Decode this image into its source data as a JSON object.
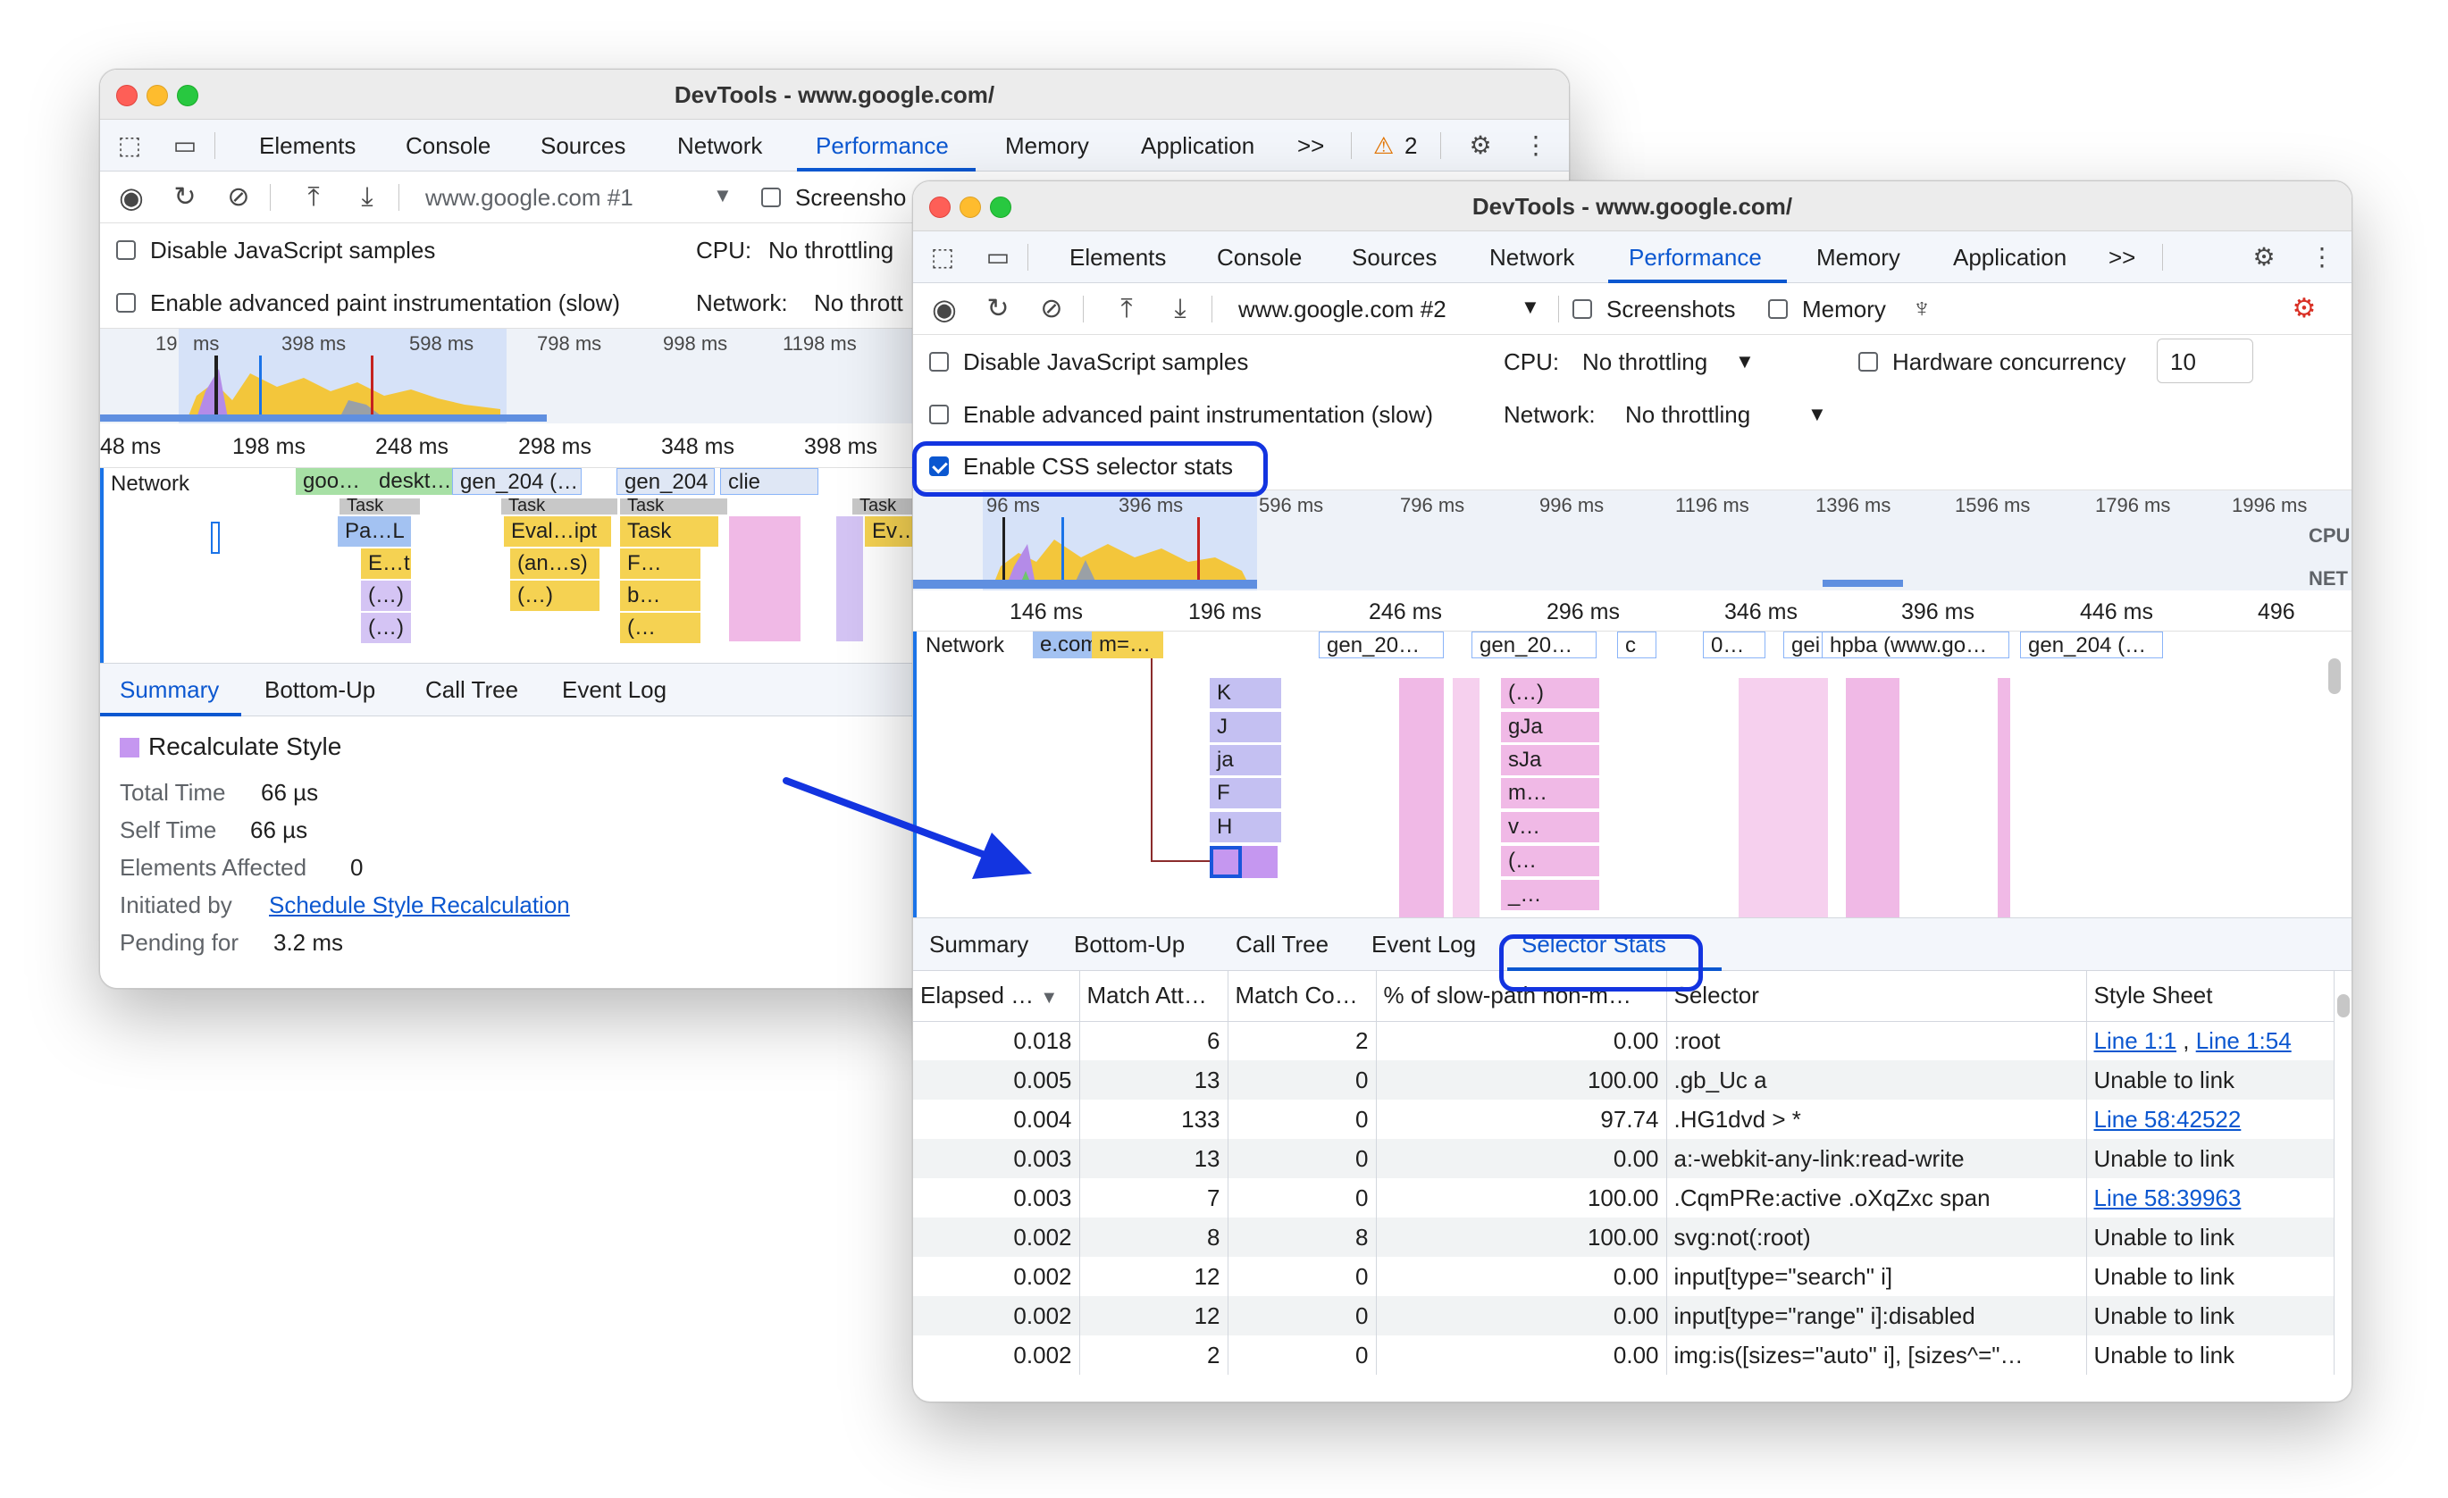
{
  "win1": {
    "title": "DevTools - www.google.com/",
    "tabs": [
      "Elements",
      "Console",
      "Sources",
      "Network",
      "Performance",
      "Memory",
      "Application"
    ],
    "more_tabs": ">>",
    "warning_count": "2",
    "url_select": "www.google.com #1",
    "screenshots_label": "Screensho",
    "disable_js_label": "Disable JavaScript samples",
    "cpu_label": "CPU:",
    "cpu_value": "No throttling",
    "paint_label": "Enable advanced paint instrumentation (slow)",
    "network_label": "Network:",
    "network_value": "No thrott",
    "overview_ticks": [
      "19",
      "ms",
      "398 ms",
      "598 ms",
      "798 ms",
      "998 ms",
      "1198 ms"
    ],
    "ruler_ticks": [
      "48 ms",
      "198 ms",
      "248 ms",
      "298 ms",
      "348 ms",
      "398 ms"
    ],
    "network_track_label": "Network",
    "network_items": [
      "goo…",
      "deskt…",
      "gen_204 (…",
      "gen_204",
      "clie"
    ],
    "flame_labels": [
      "Task",
      "Task",
      "Task",
      "Task",
      "Pa…L",
      "Eval…ipt",
      "Task",
      "Ev…t",
      "E…t",
      "(an…s)",
      "F…",
      "(…)",
      "(…)",
      "b…",
      "(…)",
      "(…"
    ],
    "panel_tabs": [
      "Summary",
      "Bottom-Up",
      "Call Tree",
      "Event Log"
    ],
    "summary": {
      "title": "Recalculate Style",
      "total_time_label": "Total Time",
      "total_time": "66 µs",
      "self_time_label": "Self Time",
      "self_time": "66 µs",
      "elements_label": "Elements Affected",
      "elements": "0",
      "initiated_label": "Initiated by",
      "initiated_link": "Schedule Style Recalculation",
      "pending_label": "Pending for",
      "pending": "3.2 ms"
    }
  },
  "win2": {
    "title": "DevTools - www.google.com/",
    "tabs": [
      "Elements",
      "Console",
      "Sources",
      "Network",
      "Performance",
      "Memory",
      "Application"
    ],
    "more_tabs": ">>",
    "url_select": "www.google.com #2",
    "screenshots_label": "Screenshots",
    "memory_label": "Memory",
    "disable_js_label": "Disable JavaScript samples",
    "cpu_label": "CPU:",
    "cpu_value": "No throttling",
    "hw_label": "Hardware concurrency",
    "hw_value": "10",
    "paint_label": "Enable advanced paint instrumentation (slow)",
    "network_label": "Network:",
    "network_value": "No throttling",
    "css_stats_label": "Enable CSS selector stats",
    "overview_ticks": [
      "96 ms",
      "396 ms",
      "596 ms",
      "796 ms",
      "996 ms",
      "1196 ms",
      "1396 ms",
      "1596 ms",
      "1796 ms",
      "1996 ms"
    ],
    "cpu_lane": "CPU",
    "net_lane": "NET",
    "ruler_ticks": [
      "146 ms",
      "196 ms",
      "246 ms",
      "296 ms",
      "346 ms",
      "396 ms",
      "446 ms",
      "496"
    ],
    "network_track_label": "Network",
    "network_items": [
      "e.com",
      "m=…",
      "gen_20…",
      "gen_20…",
      "c",
      "0…",
      "gei",
      "hpba (www.go…",
      "gen_204 (…"
    ],
    "flame_labels": [
      "K",
      "J",
      "ja",
      "F",
      "H",
      "(…)",
      "gJa",
      "sJa",
      "m…",
      "v…",
      "(…",
      "_…"
    ],
    "panel_tabs": [
      "Summary",
      "Bottom-Up",
      "Call Tree",
      "Event Log",
      "Selector Stats"
    ],
    "table": {
      "headers": [
        "Elapsed …",
        "Match Att…",
        "Match Co…",
        "% of slow-path non-m…",
        "Selector",
        "Style Sheet"
      ],
      "rows": [
        {
          "elapsed": "0.018",
          "attempts": "6",
          "count": "2",
          "pct": "0.00",
          "selector": ":root",
          "sheet": "Line 1:1",
          "sheet2": "Line 1:54"
        },
        {
          "elapsed": "0.005",
          "attempts": "13",
          "count": "0",
          "pct": "100.00",
          "selector": ".gb_Uc a",
          "sheet": "Unable to link"
        },
        {
          "elapsed": "0.004",
          "attempts": "133",
          "count": "0",
          "pct": "97.74",
          "selector": ".HG1dvd > *",
          "sheet": "Line 58:42522"
        },
        {
          "elapsed": "0.003",
          "attempts": "13",
          "count": "0",
          "pct": "0.00",
          "selector": "a:-webkit-any-link:read-write",
          "sheet": "Unable to link"
        },
        {
          "elapsed": "0.003",
          "attempts": "7",
          "count": "0",
          "pct": "100.00",
          "selector": ".CqmPRe:active .oXqZxc span",
          "sheet": "Line 58:39963"
        },
        {
          "elapsed": "0.002",
          "attempts": "8",
          "count": "8",
          "pct": "100.00",
          "selector": "svg:not(:root)",
          "sheet": "Unable to link"
        },
        {
          "elapsed": "0.002",
          "attempts": "12",
          "count": "0",
          "pct": "0.00",
          "selector": "input[type=\"search\" i]",
          "sheet": "Unable to link"
        },
        {
          "elapsed": "0.002",
          "attempts": "12",
          "count": "0",
          "pct": "0.00",
          "selector": "input[type=\"range\" i]:disabled",
          "sheet": "Unable to link"
        },
        {
          "elapsed": "0.002",
          "attempts": "2",
          "count": "0",
          "pct": "0.00",
          "selector": "img:is([sizes=\"auto\" i], [sizes^=\"…",
          "sheet": "Unable to link"
        }
      ]
    }
  },
  "colors": {
    "accent": "#0b57d0",
    "highlight": "#1334e0",
    "recalc_style": "#c597f0"
  }
}
